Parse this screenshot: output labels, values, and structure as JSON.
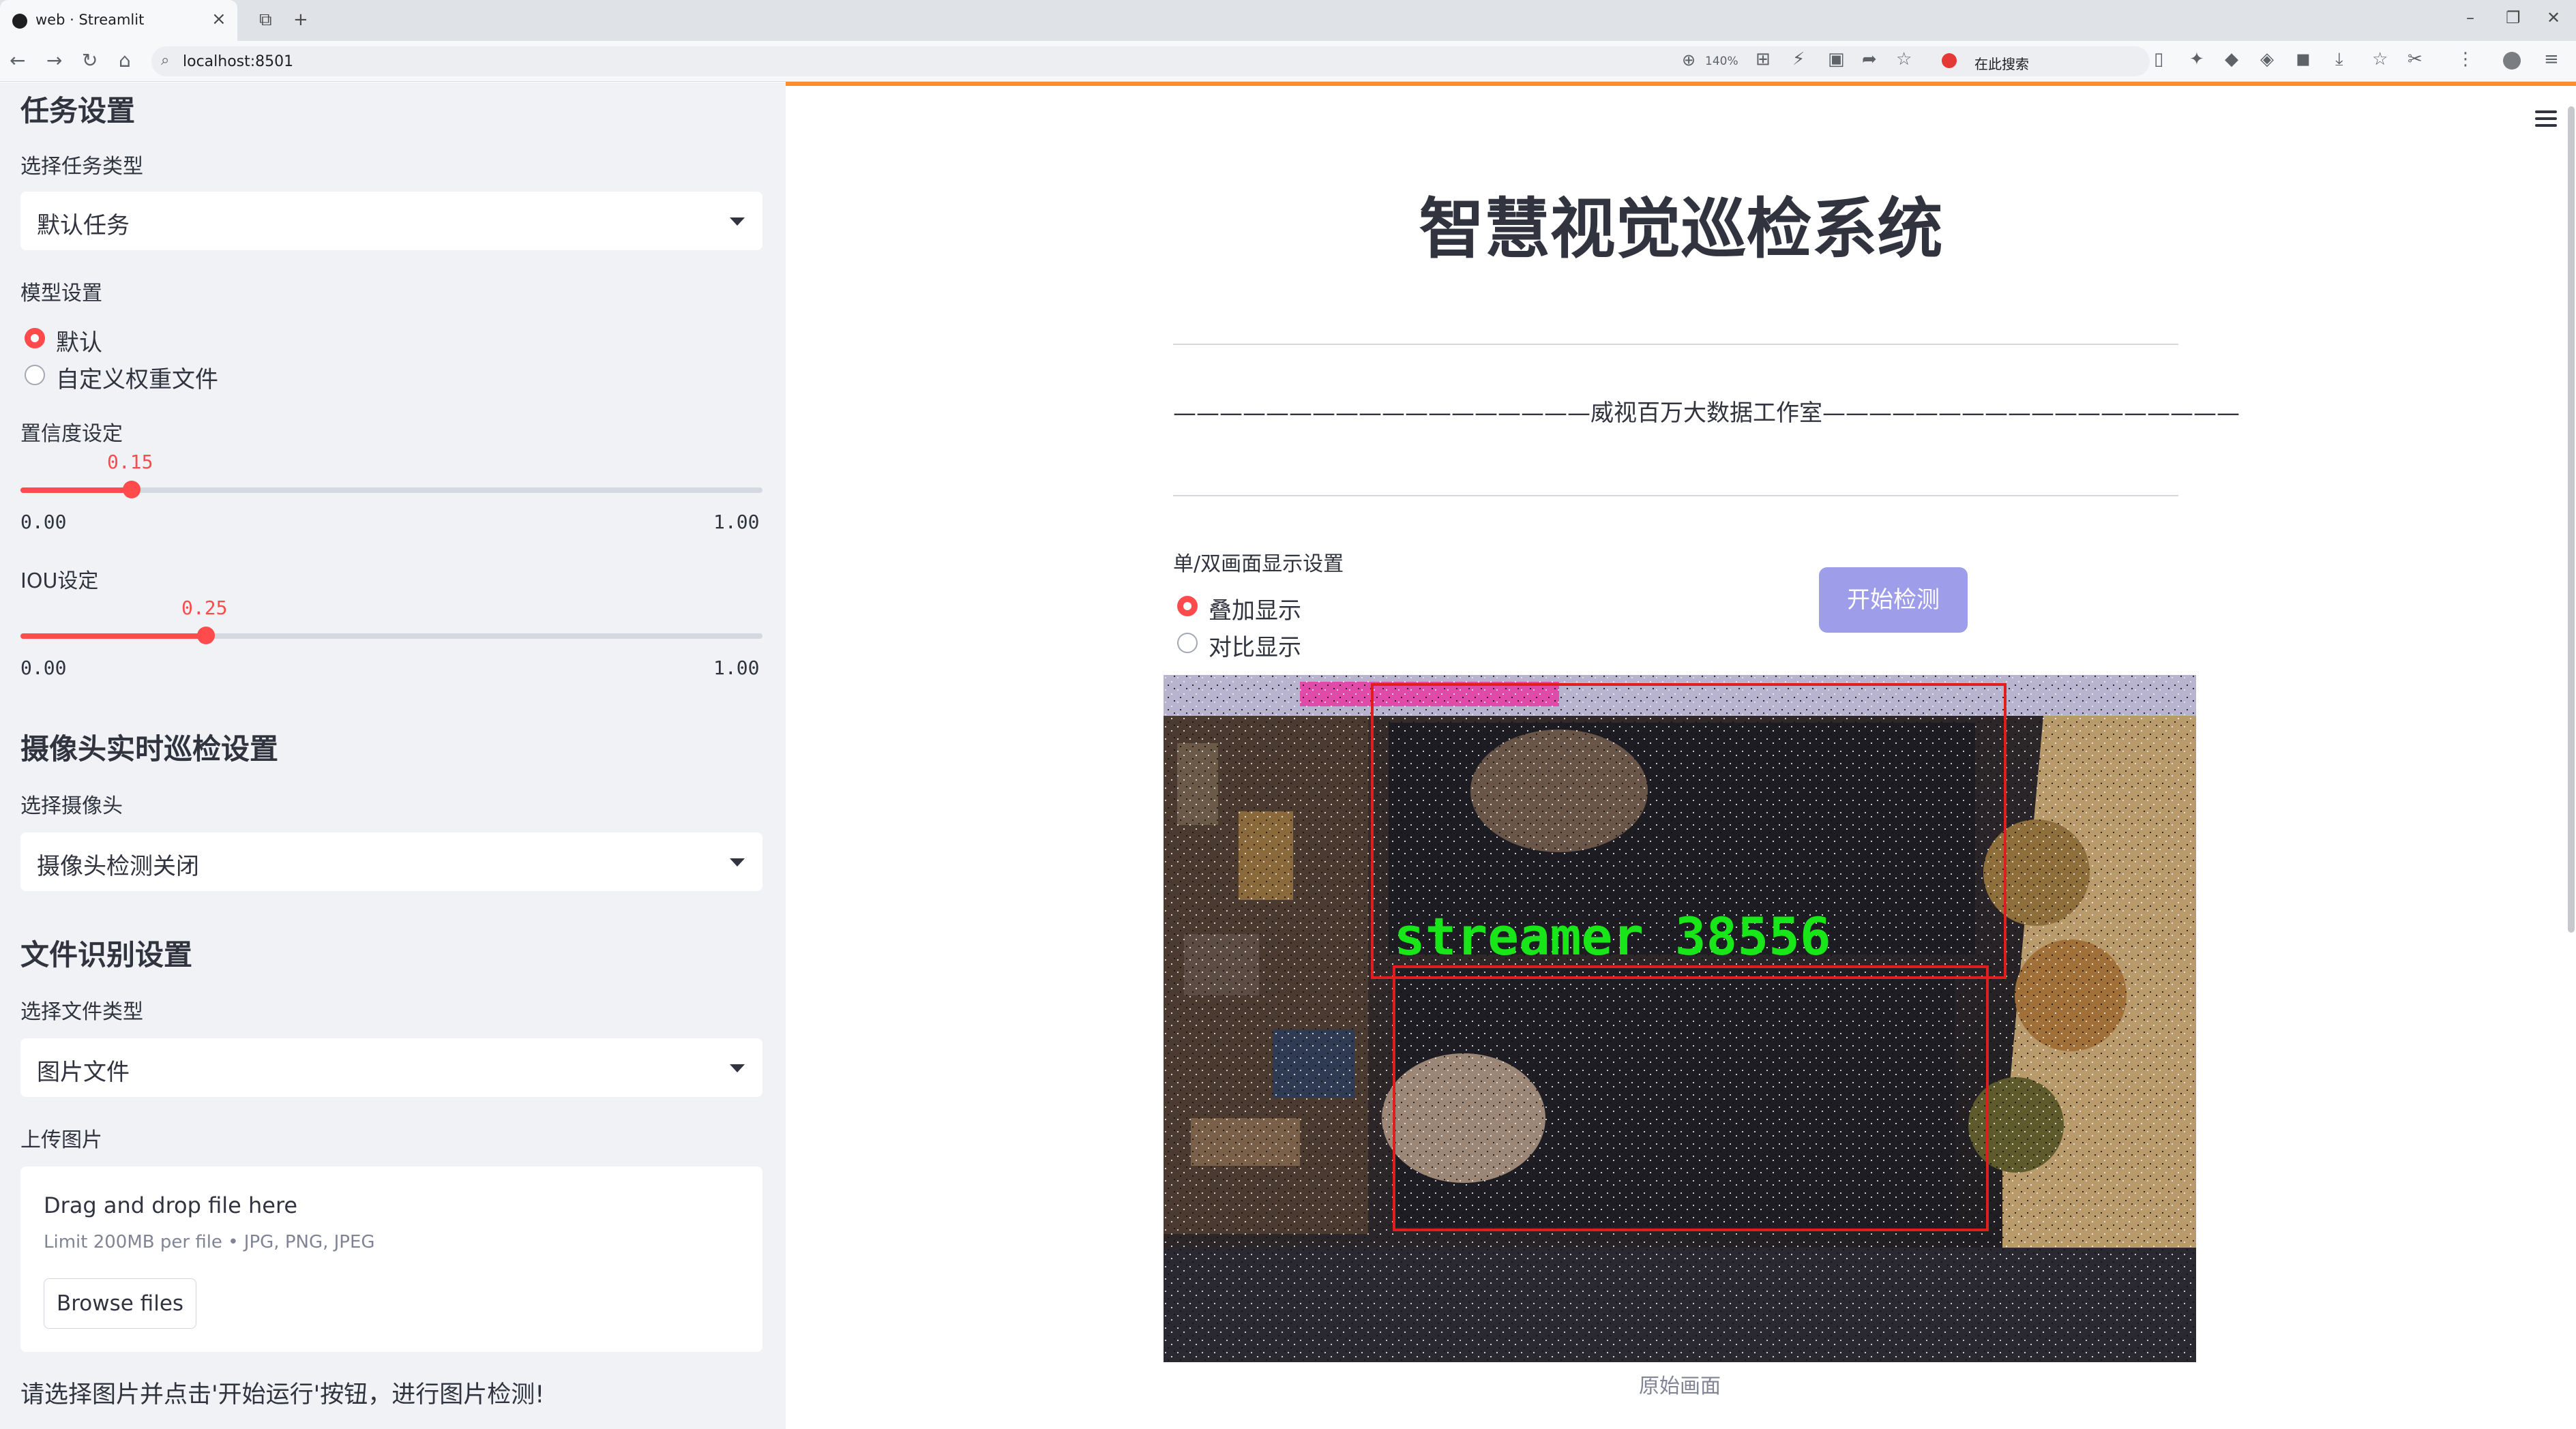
{
  "browser": {
    "tab_title": "web · Streamlit",
    "url": "localhost:8501",
    "zoom": "140%",
    "search_placeholder": "在此搜索"
  },
  "sidebar": {
    "task_section": {
      "heading": "任务设置",
      "type_label": "选择任务类型",
      "type_value": "默认任务"
    },
    "model_section": {
      "label": "模型设置",
      "options": [
        "默认",
        "自定义权重文件"
      ],
      "selected": "默认"
    },
    "confidence": {
      "label": "置信度设定",
      "value": 0.15,
      "value_text": "0.15",
      "min_text": "0.00",
      "max_text": "1.00"
    },
    "iou": {
      "label": "IOU设定",
      "value": 0.25,
      "value_text": "0.25",
      "min_text": "0.00",
      "max_text": "1.00"
    },
    "camera_section": {
      "heading": "摄像头实时巡检设置",
      "label": "选择摄像头",
      "value": "摄像头检测关闭"
    },
    "file_section": {
      "heading": "文件识别设置",
      "type_label": "选择文件类型",
      "type_value": "图片文件",
      "upload_label": "上传图片",
      "drop_text": "Drag and drop file here",
      "limit_text": "Limit 200MB per file • JPG, PNG, JPEG",
      "browse_label": "Browse files"
    },
    "note": "请选择图片并点击'开始运行'按钮，进行图片检测!"
  },
  "main": {
    "title": "智慧视觉巡检系统",
    "subtitle": "——————————————————威视百万大数据工作室——————————————————",
    "display_label": "单/双画面显示设置",
    "display_options": [
      "叠加显示",
      "对比显示"
    ],
    "display_selected": "叠加显示",
    "start_button": "开始检测",
    "detection_label": "streamer 38556",
    "caption": "原始画面"
  },
  "colors": {
    "accent": "#ff4b4b",
    "button": "#9e9dea",
    "sidebar_bg": "#f0f2f6",
    "detection_box": "#e01e1e",
    "detection_text": "#19e619"
  }
}
